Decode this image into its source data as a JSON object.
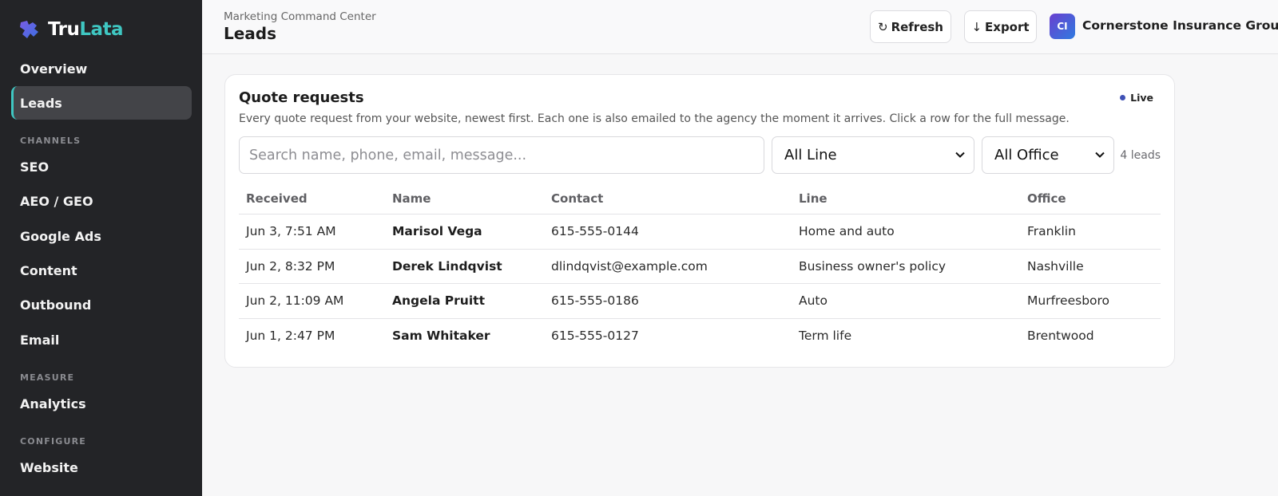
{
  "brand": {
    "part1": "Tru",
    "part2": "Lata"
  },
  "sidebar": {
    "items": [
      {
        "label": "Overview"
      },
      {
        "label": "Leads",
        "active": true
      }
    ],
    "channels_heading": "CHANNELS",
    "channels": [
      {
        "label": "SEO"
      },
      {
        "label": "AEO / GEO"
      },
      {
        "label": "Google Ads"
      },
      {
        "label": "Content"
      },
      {
        "label": "Outbound"
      },
      {
        "label": "Email"
      }
    ],
    "measure_heading": "MEASURE",
    "measure": [
      {
        "label": "Analytics"
      }
    ],
    "configure_heading": "CONFIGURE",
    "configure": [
      {
        "label": "Website"
      }
    ]
  },
  "header": {
    "breadcrumb": "Marketing Command Center",
    "title": "Leads",
    "refresh_label": "Refresh",
    "export_label": "Export",
    "avatar_initials": "CI",
    "org_name": "Cornerstone Insurance Group"
  },
  "card": {
    "title": "Quote requests",
    "live_label": "Live",
    "description": "Every quote request from your website, newest first. Each one is also emailed to the agency the moment it arrives. Click a row for the full message.",
    "search_placeholder": "Search name, phone, email, message...",
    "line_filter": "All Line",
    "office_filter": "All Office",
    "count_text": "4 leads"
  },
  "table": {
    "columns": [
      "Received",
      "Name",
      "Contact",
      "Line",
      "Office"
    ],
    "rows": [
      {
        "received": "Jun 3, 7:51 AM",
        "name": "Marisol Vega",
        "contact": "615-555-0144",
        "line": "Home and auto",
        "office": "Franklin"
      },
      {
        "received": "Jun 2, 8:32 PM",
        "name": "Derek Lindqvist",
        "contact": "dlindqvist@example.com",
        "line": "Business owner's policy",
        "office": "Nashville"
      },
      {
        "received": "Jun 2, 11:09 AM",
        "name": "Angela Pruitt",
        "contact": "615-555-0186",
        "line": "Auto",
        "office": "Murfreesboro"
      },
      {
        "received": "Jun 1, 2:47 PM",
        "name": "Sam Whitaker",
        "contact": "615-555-0127",
        "line": "Term life",
        "office": "Brentwood"
      }
    ]
  },
  "colors": {
    "sidebar_bg": "#232427",
    "accent": "#3fc7c2",
    "live_dot": "#3f51b5"
  },
  "icons": {
    "logo": "puzzle-logo-icon",
    "refresh": "refresh-icon",
    "export": "arrow-down-icon",
    "select": "chevron-down-icon"
  }
}
